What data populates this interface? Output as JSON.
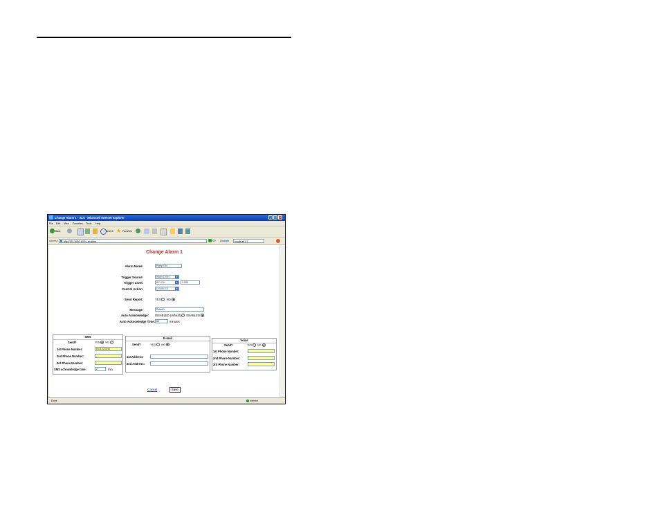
{
  "window": {
    "title": "Change Alarm 1 - 32.6 - Microsoft Internet Explorer"
  },
  "menu": [
    "File",
    "Edit",
    "View",
    "Favorites",
    "Tools",
    "Help"
  ],
  "toolbar": {
    "back_label": "Back",
    "search_label": "Search",
    "favorites_label": "Favorites"
  },
  "address": {
    "label": "Address",
    "url": "http://192.168.0.100/x_ab.dhtm",
    "go_label": "Go",
    "google_label": "Google",
    "google_value": "hooda ab C1"
  },
  "form": {
    "heading": "Change Alarm 1",
    "alarm_name_label": "Alarm Name:",
    "alarm_name_value": "Pump ON",
    "trigger_source_label": "Trigger Source:",
    "trigger_source_value": "Water Level",
    "trigger_level_label": "Trigger Level:",
    "trigger_level_value": "BELOW",
    "trigger_level_number": "1.000",
    "control_action_label": "Control Action:",
    "control_action_value": "DISABLED",
    "send_report_label": "Send Report:",
    "yes_label": "YES",
    "no_label": "NO",
    "message_label": "Message:",
    "message_value": "Driver0",
    "auto_ack_label": "Auto Acknowledge:",
    "auto_ack_disabled": "DISABLED (default)",
    "auto_ack_enabled": "ENABLED",
    "auto_ack_time_label": "Auto Acknowledge Time:",
    "auto_ack_time_value": "60",
    "auto_ack_time_unit": "minutes"
  },
  "sms": {
    "title": "SMS",
    "send_label": "Send?",
    "yes": "YES",
    "no": "NO",
    "phone1_label": "1st Phone Number:",
    "phone1_value": "0411223344",
    "phone2_label": "2nd Phone Number:",
    "phone3_label": "3rd Phone Number:",
    "ack_time_label": "SMS achnowledge time:",
    "ack_time_value": "2",
    "ack_time_unit": "min"
  },
  "email": {
    "title": "E-mail",
    "send_label": "Send?",
    "yes": "YES",
    "no": "NO",
    "addr1_label": "1st Address:",
    "addr2_label": "2nd Address:"
  },
  "voice": {
    "title": "Voice",
    "send_label": "Send?",
    "yes": "YES",
    "no": "NO",
    "phone1_label": "1st Phone Number:",
    "phone2_label": "2nd Phone Number:",
    "phone3_label": "3rd Phone Number:"
  },
  "actions": {
    "cancel": "Cancel",
    "save": "Save"
  },
  "status": {
    "left": "Done",
    "zone": "Internet"
  }
}
